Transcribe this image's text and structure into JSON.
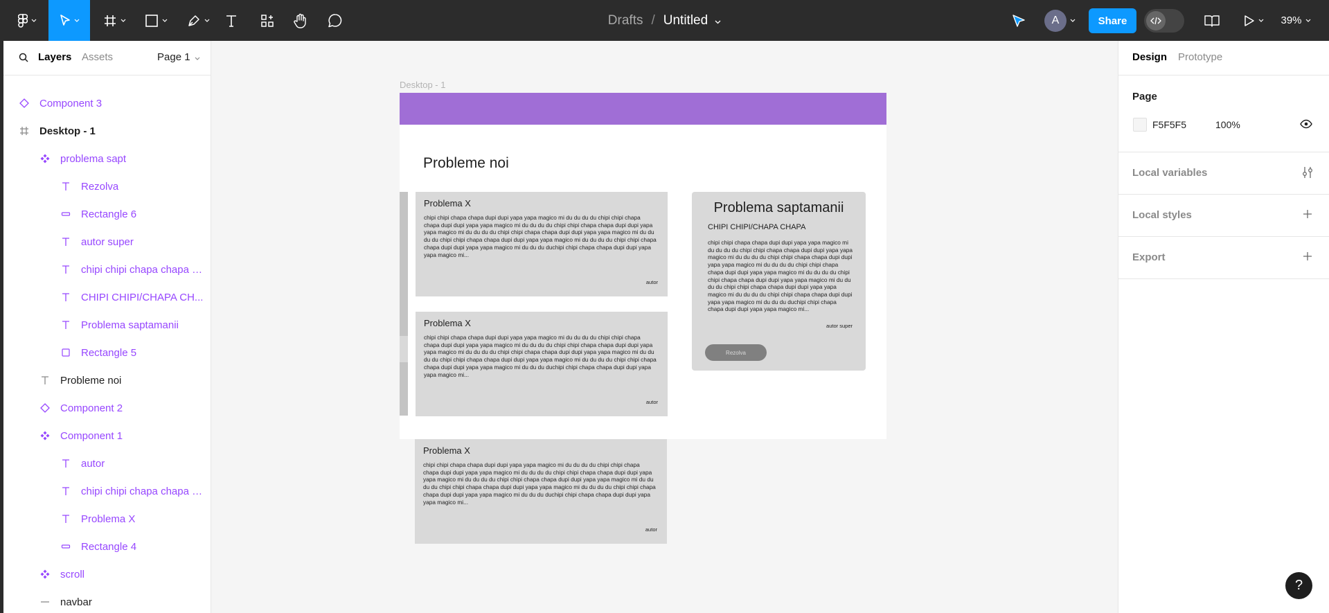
{
  "toolbar": {
    "tools": [
      {
        "name": "main-menu",
        "icon": "figma-logo-icon"
      },
      {
        "name": "move-tool",
        "icon": "cursor-icon"
      },
      {
        "name": "frame-tool",
        "icon": "frame-icon"
      },
      {
        "name": "shape-tool",
        "icon": "rectangle-icon"
      },
      {
        "name": "pen-tool",
        "icon": "pen-icon"
      },
      {
        "name": "text-tool",
        "icon": "text-icon"
      },
      {
        "name": "resources-tool",
        "icon": "resources-icon"
      },
      {
        "name": "hand-tool",
        "icon": "hand-icon"
      },
      {
        "name": "comment-tool",
        "icon": "comment-icon"
      }
    ],
    "breadcrumb_project": "Drafts",
    "breadcrumb_separator": "/",
    "doc_title": "Untitled",
    "avatar_initial": "A",
    "share_label": "Share",
    "zoom": "39%"
  },
  "left_panel": {
    "tab_layers": "Layers",
    "tab_assets": "Assets",
    "page_selector": "Page 1",
    "layers": [
      {
        "name": "Component 3",
        "icon": "component-icon",
        "indent": 0,
        "color": "purple"
      },
      {
        "name": "Desktop - 1",
        "icon": "frame-icon",
        "indent": 0,
        "color": "dark",
        "bold": true
      },
      {
        "name": "problema sapt",
        "icon": "component-instance-icon",
        "indent": 1,
        "color": "purple"
      },
      {
        "name": "Rezolva",
        "icon": "text-icon",
        "indent": 2,
        "color": "purple"
      },
      {
        "name": "Rectangle 6",
        "icon": "rectangle-flat-icon",
        "indent": 2,
        "color": "purple"
      },
      {
        "name": "autor super",
        "icon": "text-icon",
        "indent": 2,
        "color": "purple"
      },
      {
        "name": "chipi chipi chapa chapa d...",
        "icon": "text-icon",
        "indent": 2,
        "color": "purple"
      },
      {
        "name": "CHIPI CHIPI/CHAPA CH...",
        "icon": "text-icon",
        "indent": 2,
        "color": "purple"
      },
      {
        "name": "Problema saptamanii",
        "icon": "text-icon",
        "indent": 2,
        "color": "purple"
      },
      {
        "name": "Rectangle 5",
        "icon": "rectangle-icon",
        "indent": 2,
        "color": "purple"
      },
      {
        "name": "Probleme noi",
        "icon": "text-icon",
        "indent": 1,
        "color": "dark"
      },
      {
        "name": "Component 2",
        "icon": "component-icon",
        "indent": 1,
        "color": "purple"
      },
      {
        "name": "Component 1",
        "icon": "component-instance-icon",
        "indent": 1,
        "color": "purple"
      },
      {
        "name": "autor",
        "icon": "text-icon",
        "indent": 2,
        "color": "purple"
      },
      {
        "name": "chipi chipi chapa chapa d...",
        "icon": "text-icon",
        "indent": 2,
        "color": "purple"
      },
      {
        "name": "Problema X",
        "icon": "text-icon",
        "indent": 2,
        "color": "purple"
      },
      {
        "name": "Rectangle 4",
        "icon": "rectangle-flat-icon",
        "indent": 2,
        "color": "purple"
      },
      {
        "name": "scroll",
        "icon": "component-instance-icon",
        "indent": 1,
        "color": "purple"
      },
      {
        "name": "navbar",
        "icon": "line-icon",
        "indent": 1,
        "color": "dark"
      }
    ]
  },
  "canvas": {
    "frame_label": "Desktop - 1",
    "heading": "Probleme noi",
    "cards": [
      {
        "title": "Problema X",
        "body": "chipi chipi chapa chapa dupi dupi yapa yapa magico mi du du du du chipi chipi chapa chapa dupi dupi yapa yapa magico mi du du du du chipi chipi chapa chapa dupi dupi yapa yapa magico mi du du du du chipi chipi chapa chapa dupi dupi yapa yapa magico mi du du du du chipi chipi chapa chapa dupi dupi yapa yapa magico mi du du du du chipi chipi chapa chapa dupi dupi yapa yapa magico mi du du du duchipi chipi chapa chapa dupi dupi yapa yapa magico mi...",
        "autor": "autor"
      },
      {
        "title": "Problema X",
        "body": "chipi chipi chapa chapa dupi dupi yapa yapa magico mi du du du du chipi chipi chapa chapa dupi dupi yapa yapa magico mi du du du du chipi chipi chapa chapa dupi dupi yapa yapa magico mi du du du du chipi chipi chapa chapa dupi dupi yapa yapa magico mi du du du du chipi chipi chapa chapa dupi dupi yapa yapa magico mi du du du du chipi chipi chapa chapa dupi dupi yapa yapa magico mi du du du duchipi chipi chapa chapa dupi dupi yapa yapa magico mi...",
        "autor": "autor"
      },
      {
        "title": "Problema X",
        "body": "chipi chipi chapa chapa dupi dupi yapa yapa magico mi du du du du chipi chipi chapa chapa dupi dupi yapa yapa magico mi du du du du chipi chipi chapa chapa dupi dupi yapa yapa magico mi du du du du chipi chipi chapa chapa dupi dupi yapa yapa magico mi du du du du chipi chipi chapa chapa dupi dupi yapa yapa magico mi du du du du chipi chipi chapa chapa dupi dupi yapa yapa magico mi du du du duchipi chipi chapa chapa dupi dupi yapa yapa magico mi...",
        "autor": "autor"
      }
    ],
    "featured": {
      "title": "Problema saptamanii",
      "subtitle": "CHIPI CHIPI/CHAPA CHAPA",
      "body": "chipi chipi chapa chapa dupi dupi yapa yapa magico mi du du du du chipi chipi chapa chapa dupi dupi yapa yapa magico mi du du du du chipi chipi chapa chapa dupi dupi yapa yapa magico mi du du du du chipi chipi chapa chapa dupi dupi yapa yapa magico mi du du du du chipi chipi chapa chapa dupi dupi yapa yapa magico mi du du du du chipi chipi chapa chapa dupi dupi yapa yapa magico mi du du du du chipi chipi chapa chapa dupi dupi yapa yapa magico mi du du du duchipi chipi chapa chapa dupi dupi yapa yapa magico mi...",
      "autor": "autor super",
      "button": "Rezolva"
    }
  },
  "right_panel": {
    "tab_design": "Design",
    "tab_prototype": "Prototype",
    "page_label": "Page",
    "page_color": "F5F5F5",
    "page_opacity": "100%",
    "local_variables": "Local variables",
    "local_styles": "Local styles",
    "export": "Export"
  },
  "help_label": "?",
  "colors": {
    "accent": "#0d99ff",
    "toolbar_bg": "#2c2c2c",
    "component_purple": "#9747ff",
    "navbar_purple": "#a06ed6",
    "canvas_bg": "#f5f5f5",
    "card_bg": "#d9d9d9"
  }
}
